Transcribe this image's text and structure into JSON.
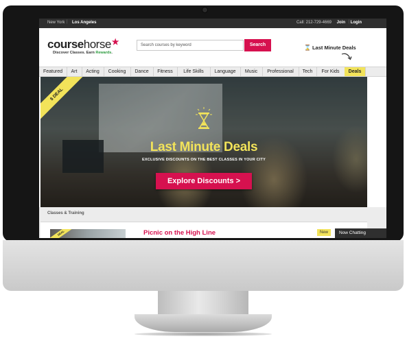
{
  "topbar": {
    "city_ny": "New York",
    "separator": "|",
    "city_la": "Los Angeles",
    "call": "Call: 212-729-4669",
    "join": "Join",
    "login": "Login"
  },
  "header": {
    "logo_course": "course",
    "logo_horse": "horse",
    "logo_star": "★",
    "tagline_start": "Discover Classes. Earn ",
    "tagline_rewards": "Rewards",
    "tagline_end": ".",
    "search_placeholder": "Search courses by keyword",
    "search_button": "Search",
    "last_minute_link": "Last Minute Deals",
    "hourglass_glyph": "⌛"
  },
  "nav": {
    "tabs": [
      "Featured",
      "Art",
      "Acting",
      "Cooking",
      "Dance",
      "Fitness",
      "Life Skills",
      "Language",
      "Music",
      "Professional",
      "Tech",
      "For Kids",
      "Deals"
    ]
  },
  "hero": {
    "ribbon": "$ DEAL",
    "title": "Last Minute Deals",
    "subtitle": "EXCLUSIVE DISCOUNTS ON THE BEST CLASSES IN YOUR CITY",
    "cta": "Explore Discounts >"
  },
  "section": {
    "label": "Classes & Training",
    "card_ribbon": "DEAL",
    "card_title": "Picnic on the High Line",
    "card_badge": "New"
  },
  "chat": {
    "label": "Now Chatting"
  },
  "colors": {
    "brand_pink": "#d6114f",
    "deals_yellow": "#f2e35a",
    "rewards_green": "#2a9a3c",
    "topbar_dark": "#2f2f2f"
  }
}
